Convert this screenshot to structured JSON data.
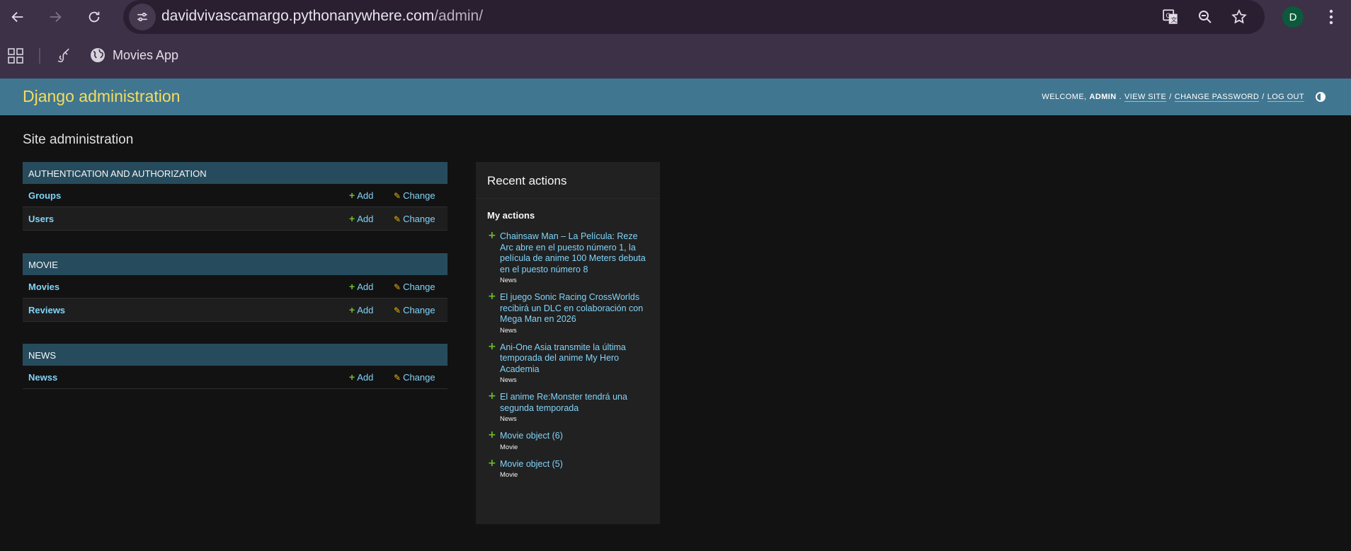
{
  "browser": {
    "url_host": "davidvivascamargo.pythonanywhere.com",
    "url_path": "/admin/",
    "avatar_letter": "D",
    "bookmarks": [
      {
        "icon": "bookmark-app-icon",
        "label": ""
      },
      {
        "icon": "globe-icon",
        "label": "Movies App"
      }
    ]
  },
  "header": {
    "branding": "Django administration",
    "welcome": "Welcome,",
    "username": "admin",
    "view_site": "View site",
    "change_password": "Change password",
    "log_out": "Log out",
    "sep": "/"
  },
  "content": {
    "title": "Site administration",
    "modules": [
      {
        "caption": "Authentication and Authorization",
        "models": [
          {
            "name": "Groups",
            "add": "Add",
            "change": "Change"
          },
          {
            "name": "Users",
            "add": "Add",
            "change": "Change"
          }
        ]
      },
      {
        "caption": "Movie",
        "models": [
          {
            "name": "Movies",
            "add": "Add",
            "change": "Change"
          },
          {
            "name": "Reviews",
            "add": "Add",
            "change": "Change"
          }
        ]
      },
      {
        "caption": "News",
        "models": [
          {
            "name": "Newss",
            "add": "Add",
            "change": "Change"
          }
        ]
      }
    ]
  },
  "recent": {
    "title": "Recent actions",
    "subtitle": "My actions",
    "actions": [
      {
        "title": "Chainsaw Man – La Película: Reze Arc abre en el puesto número 1, la película de anime 100 Meters debuta en el puesto número 8",
        "type": "News"
      },
      {
        "title": "El juego Sonic Racing CrossWorlds recibirá un DLC en colaboración con Mega Man en 2026",
        "type": "News"
      },
      {
        "title": "Ani-One Asia transmite la última temporada del anime My Hero Academia",
        "type": "News"
      },
      {
        "title": "El anime Re:Monster tendrá una segunda temporada",
        "type": "News"
      },
      {
        "title": "Movie object (6)",
        "type": "Movie"
      },
      {
        "title": "Movie object (5)",
        "type": "Movie"
      }
    ]
  },
  "colors": {
    "header_bg": "#417690",
    "branding": "#f5dd5d",
    "link": "#81d4fa",
    "caption_bg": "#264b5d",
    "add_icon": "#70bf2b",
    "change_icon": "#efb80b"
  }
}
